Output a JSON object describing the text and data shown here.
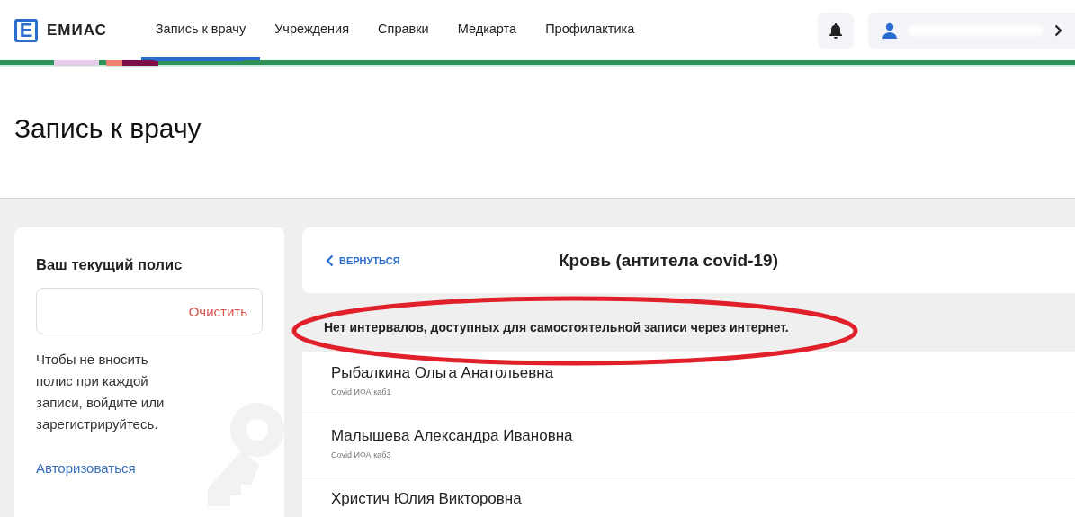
{
  "header": {
    "logo_letter": "Е",
    "logo_text": "ЕМИАС",
    "nav": [
      {
        "label": "Запись к врачу",
        "selected": true
      },
      {
        "label": "Учреждения",
        "selected": false
      },
      {
        "label": "Справки",
        "selected": false
      },
      {
        "label": "Медкарта",
        "selected": false
      },
      {
        "label": "Профилактика",
        "selected": false
      }
    ]
  },
  "page_title": "Запись к врачу",
  "policy_card": {
    "title": "Ваш текущий полис",
    "clear_button": "Очистить",
    "hint": "Чтобы не вносить полис при каждой записи, войдите или зарегистрируйтесь.",
    "login_link": "Авторизоваться"
  },
  "service": {
    "back_button": "ВЕРНУТЬСЯ",
    "title": "Кровь (антитела covid-19)",
    "message": "Нет интервалов, доступных для самостоятельной записи через интернет.",
    "doctors": [
      {
        "name": "Рыбалкина Ольга Анатольевна",
        "room": "Covid ИФА каб1"
      },
      {
        "name": "Малышева Александра Ивановна",
        "room": "Covid ИФА каб3"
      },
      {
        "name": "Христич Юлия Викторовна"
      }
    ]
  }
}
